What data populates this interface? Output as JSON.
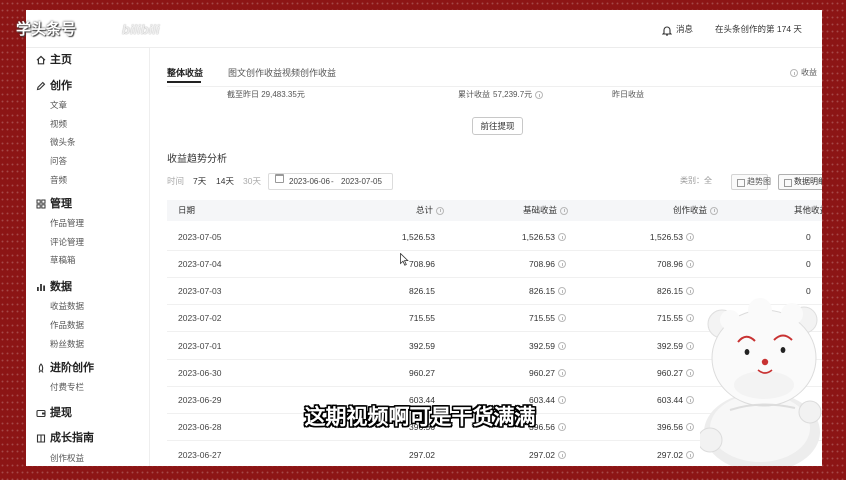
{
  "watermark": {
    "text": "学头条号",
    "platform": "bilibili"
  },
  "header": {
    "notification_label": "消息",
    "creator_days": "在头条创作的第 174 天",
    "bell_icon": "bell-icon"
  },
  "sidebar": {
    "groups": [
      {
        "label": "主页",
        "icon": "home-icon",
        "children": []
      },
      {
        "label": "创作",
        "icon": "pen-icon",
        "children": [
          "文章",
          "视频",
          "微头条",
          "问答",
          "音频"
        ]
      },
      {
        "label": "管理",
        "icon": "grid-icon",
        "children": [
          "作品管理",
          "评论管理",
          "草稿箱"
        ]
      },
      {
        "label": "数据",
        "icon": "chart-icon",
        "children": [
          "收益数据",
          "作品数据",
          "粉丝数据"
        ]
      },
      {
        "label": "进阶创作",
        "icon": "rocket-icon",
        "children": [
          "付费专栏"
        ]
      },
      {
        "label": "提现",
        "icon": "wallet-icon",
        "children": []
      },
      {
        "label": "成长指南",
        "icon": "book-icon",
        "children": [
          "创作权益"
        ]
      }
    ]
  },
  "tabs": {
    "items": [
      "整体收益",
      "图文创作收益",
      "视频创作收益"
    ],
    "active_index": 0,
    "right_link": "收益"
  },
  "summary": [
    {
      "label": "截至昨日",
      "value": "29,483.35元"
    },
    {
      "label": "累计收益",
      "value": "57,239.7元"
    },
    {
      "label": "昨日收益"
    }
  ],
  "withdraw_button": "前往提现",
  "trend": {
    "title": "收益趋势分析",
    "time_label": "时间",
    "quick_ranges": [
      "7天",
      "14天",
      "30天"
    ],
    "date_start": "2023-06-06",
    "date_separator": "-",
    "date_end": "2023-07-05",
    "category_label": "类别：",
    "category_value": "全",
    "view_buttons": [
      "趋势图",
      "数据明细"
    ],
    "active_view_index": 1
  },
  "table": {
    "headers": [
      "日期",
      "总计",
      "基础收益",
      "创作收益",
      "其他收益"
    ],
    "rows": [
      [
        "2023-07-05",
        "1,526.53",
        "1,526.53",
        "1,526.53",
        "0"
      ],
      [
        "2023-07-04",
        "708.96",
        "708.96",
        "708.96",
        "0"
      ],
      [
        "2023-07-03",
        "826.15",
        "826.15",
        "826.15",
        "0"
      ],
      [
        "2023-07-02",
        "715.55",
        "715.55",
        "715.55"
      ],
      [
        "2023-07-01",
        "392.59",
        "392.59",
        "392.59"
      ],
      [
        "2023-06-30",
        "960.27",
        "960.27",
        "960.27"
      ],
      [
        "2023-06-29",
        "603.44",
        "603.44",
        "603.44"
      ],
      [
        "2023-06-28",
        "396.56",
        "396.56",
        "396.56"
      ],
      [
        "2023-06-27",
        "297.02",
        "297.02",
        "297.02"
      ]
    ]
  },
  "subtitle": "这期视频啊可是干货满满",
  "colors": {
    "frame": "#8c1515",
    "active_tab": "#222222",
    "table_header_bg": "#f5f6f8",
    "subtitle_text": "#ffffff",
    "subtitle_stroke": "#000000"
  }
}
